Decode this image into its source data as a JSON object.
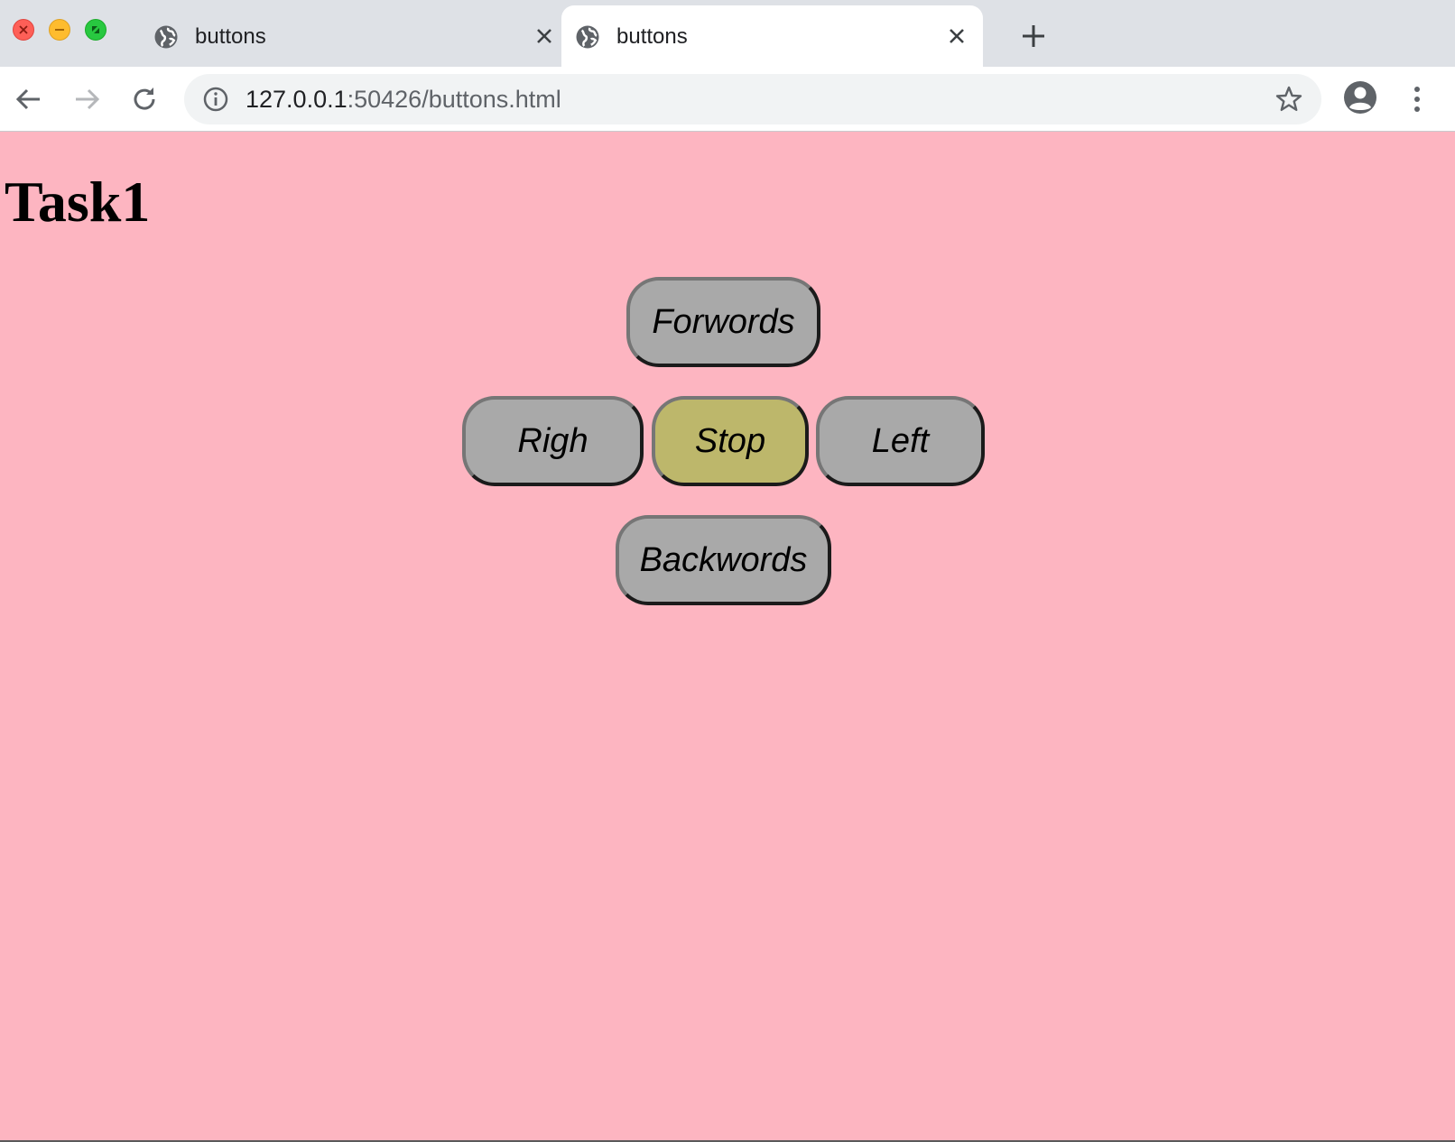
{
  "browser": {
    "tabs": [
      {
        "title": "buttons",
        "active": false
      },
      {
        "title": "buttons",
        "active": true
      }
    ],
    "address_bar": {
      "url_host": "127.0.0.1",
      "url_rest": ":50426/buttons.html"
    }
  },
  "page": {
    "background_color": "#fdb5c1",
    "heading": "Task1",
    "buttons": {
      "forward": "Forwords",
      "right": "Righ",
      "stop": "Stop",
      "left": "Left",
      "backward": "Backwords"
    },
    "colors": {
      "button_default": "#a9a9a9",
      "button_stop": "#bdb76b"
    }
  },
  "icons": {
    "tab_favicon": "globe-icon",
    "tab_close": "close-icon",
    "new_tab": "plus-icon",
    "back": "arrow-left-icon",
    "forward": "arrow-right-icon",
    "reload": "reload-icon",
    "site_info": "info-icon",
    "bookmark": "star-icon",
    "profile": "profile-icon",
    "menu": "kebab-menu-icon"
  }
}
